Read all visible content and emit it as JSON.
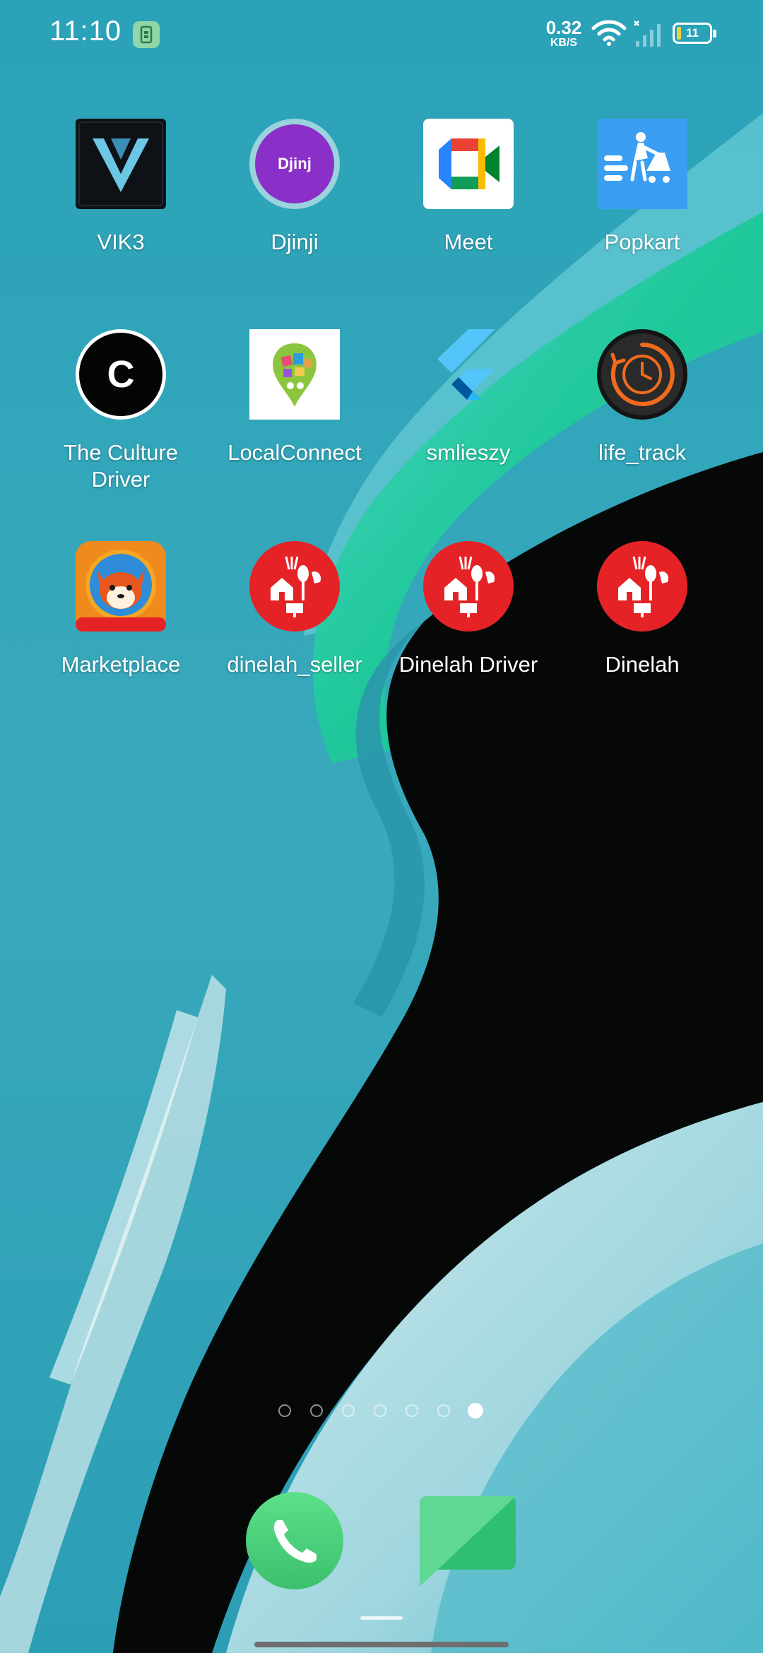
{
  "status_bar": {
    "time": "11:10",
    "net_speed_value": "0.32",
    "net_speed_unit": "KB/S",
    "battery_level": "11"
  },
  "apps": [
    {
      "label": "VIK3",
      "icon": "vik3-logo-icon"
    },
    {
      "label": "Djinji",
      "icon": "djinji-logo-icon",
      "icon_text": "Djinj"
    },
    {
      "label": "Meet",
      "icon": "google-meet-icon"
    },
    {
      "label": "Popkart",
      "icon": "popkart-cart-icon"
    },
    {
      "label": "The Culture\nDriver",
      "icon": "culture-driver-c-icon",
      "icon_text": "C"
    },
    {
      "label": "LocalConnect",
      "icon": "localconnect-pin-icon"
    },
    {
      "label": "smlieszy",
      "icon": "flutter-icon"
    },
    {
      "label": "life_track",
      "icon": "life-track-clock-icon"
    },
    {
      "label": "Marketplace",
      "icon": "shiba-marketplace-icon"
    },
    {
      "label": "dinelah_seller",
      "icon": "dinelah-icon"
    },
    {
      "label": "Dinelah Driver",
      "icon": "dinelah-icon"
    },
    {
      "label": "Dinelah",
      "icon": "dinelah-icon"
    }
  ],
  "page_indicator": {
    "pages": 7,
    "current": 7
  },
  "dock": [
    {
      "name": "Phone",
      "icon": "phone-icon"
    },
    {
      "name": "Messages",
      "icon": "messages-icon"
    }
  ],
  "colors": {
    "wallpaper_teal": "#2fa6bb",
    "dinelah_red": "#e52327",
    "popkart_blue": "#3a9ef2",
    "djinji_purple": "#8a2fc8"
  }
}
